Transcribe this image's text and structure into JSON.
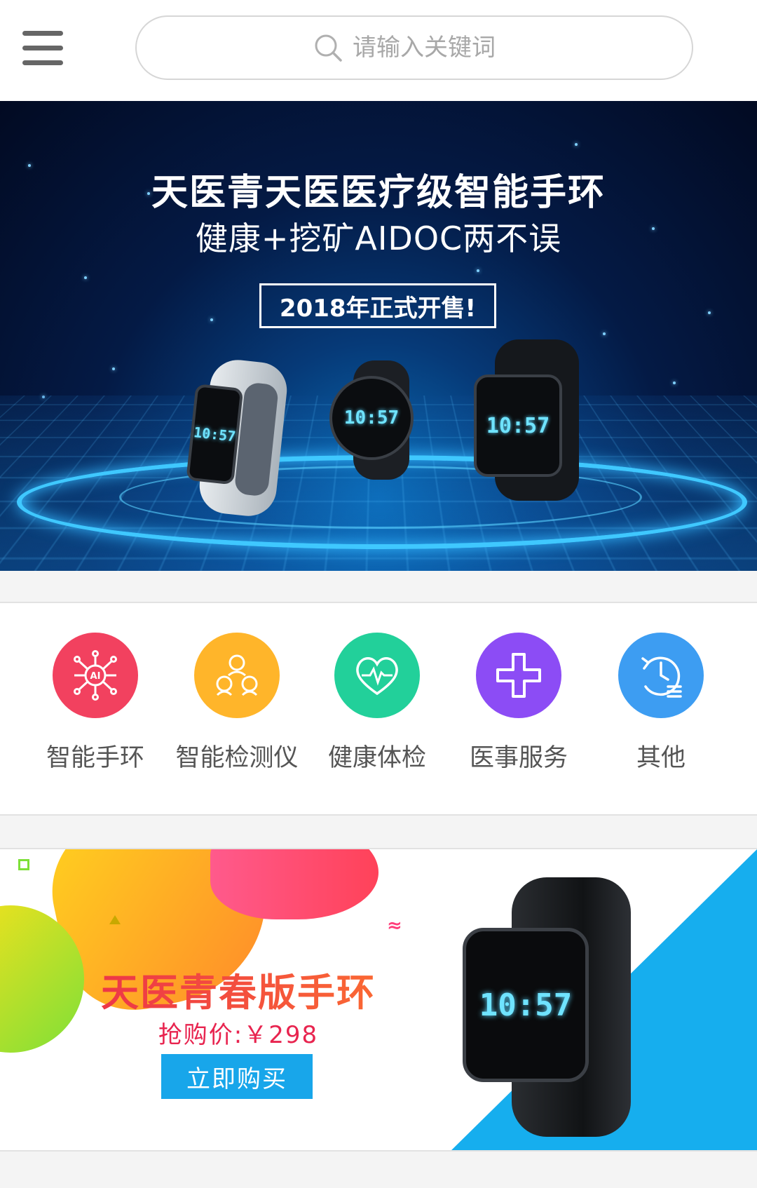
{
  "header": {
    "search_placeholder": "请输入关键词",
    "menu_icon": "hamburger-menu-icon",
    "search_icon": "search-icon"
  },
  "hero": {
    "title": "天医青天医医疗级智能手环",
    "subtitle": "健康+挖矿AIDOC两不误",
    "badge": "2018年正式开售!",
    "watch_times": [
      "10:57",
      "10:57",
      "10:57"
    ]
  },
  "categories": [
    {
      "label": "智能手环",
      "icon": "ai-network-icon",
      "color": "#f2415f"
    },
    {
      "label": "智能检测仪",
      "icon": "people-group-icon",
      "color": "#ffb52a"
    },
    {
      "label": "健康体检",
      "icon": "heart-pulse-icon",
      "color": "#22d09a"
    },
    {
      "label": "医事服务",
      "icon": "medical-cross-icon",
      "color": "#8c4cf5"
    },
    {
      "label": "其他",
      "icon": "clock-history-icon",
      "color": "#3d9df2"
    }
  ],
  "promo": {
    "title": "天医青春版手环",
    "price": "抢购价:￥298",
    "button_label": "立即购买",
    "watch_time": "10:57",
    "accent_color": "#16aeee"
  }
}
